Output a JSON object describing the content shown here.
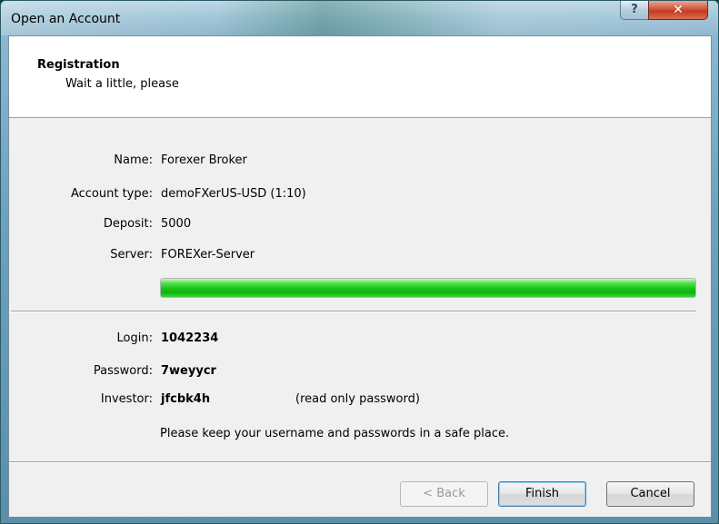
{
  "window": {
    "title": "Open an Account",
    "help_label": "?",
    "close_label": "✕"
  },
  "header": {
    "title": "Registration",
    "subtitle": "Wait a little, please"
  },
  "fields": {
    "name_label": "Name:",
    "name_value": "Forexer Broker",
    "account_type_label": "Account type:",
    "account_type_value": "demoFXerUS-USD (1:10)",
    "deposit_label": "Deposit:",
    "deposit_value": "5000",
    "server_label": "Server:",
    "server_value": "FOREXer-Server"
  },
  "progress": {
    "fraction": 1.0
  },
  "credentials": {
    "login_label": "Login:",
    "login_value": "1042234",
    "password_label": "Password:",
    "password_value": "7weyycr",
    "investor_label": "Investor:",
    "investor_value": "jfcbk4h",
    "investor_note": "(read only password)",
    "safety_note": "Please keep your username and passwords in a safe place."
  },
  "buttons": {
    "back": "< Back",
    "finish": "Finish",
    "cancel": "Cancel"
  }
}
